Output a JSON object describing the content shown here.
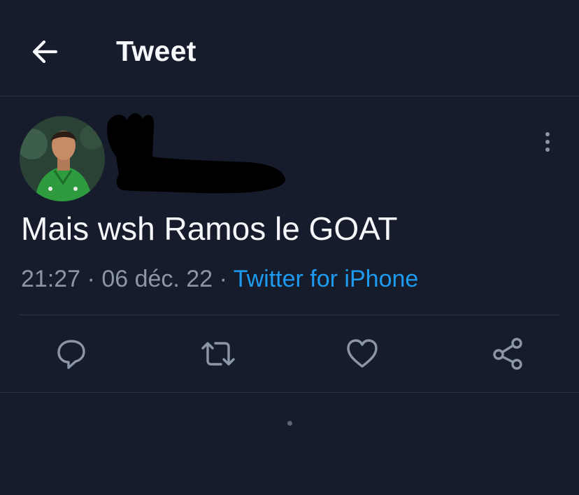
{
  "header": {
    "back_icon": "arrow-left-icon",
    "title": "Tweet"
  },
  "tweet": {
    "author_avatar": "avatar",
    "text": "Mais wsh Ramos le GOAT",
    "time": "21:27",
    "separator": "·",
    "date": "06 déc. 22",
    "source": "Twitter for iPhone"
  },
  "actions": {
    "reply_icon": "reply-icon",
    "retweet_icon": "retweet-icon",
    "like_icon": "heart-icon",
    "share_icon": "share-icon"
  },
  "colors": {
    "background": "#161c2b",
    "text": "#f5f7fa",
    "muted": "#8b97a8",
    "link": "#1d9bf0",
    "divider": "#2c3444"
  }
}
